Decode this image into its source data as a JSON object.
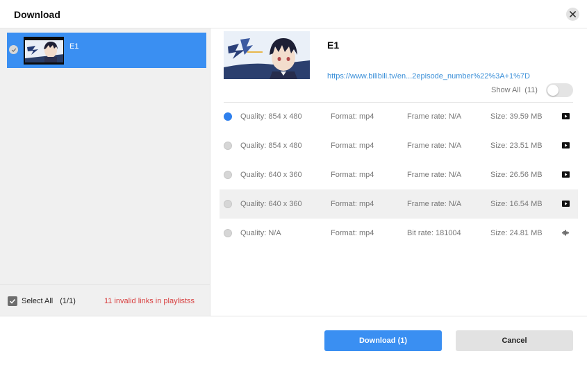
{
  "window": {
    "title": "Download"
  },
  "playlist": {
    "items": [
      {
        "title": "E1",
        "selected": true
      }
    ],
    "select_all_label": "Select All",
    "select_all_count": "(1/1)",
    "invalid_links_text": "11 invalid links in playlistss"
  },
  "video": {
    "title": "E1",
    "url": "https://www.bilibili.tv/en...2episode_number%22%3A+1%7D",
    "show_all_label": "Show All",
    "show_all_count": "(11)",
    "show_all_enabled": false
  },
  "formats": [
    {
      "quality": "Quality: 854 x 480",
      "format": "Format: mp4",
      "rate": "Frame rate: N/A",
      "size": "Size: 39.59 MB",
      "selected": true,
      "icon": "video-icon"
    },
    {
      "quality": "Quality: 854 x 480",
      "format": "Format: mp4",
      "rate": "Frame rate: N/A",
      "size": "Size: 23.51 MB",
      "selected": false,
      "icon": "video-icon"
    },
    {
      "quality": "Quality: 640 x 360",
      "format": "Format: mp4",
      "rate": "Frame rate: N/A",
      "size": "Size: 26.56 MB",
      "selected": false,
      "icon": "video-icon"
    },
    {
      "quality": "Quality: 640 x 360",
      "format": "Format: mp4",
      "rate": "Frame rate: N/A",
      "size": "Size: 16.54 MB",
      "selected": false,
      "icon": "video-icon",
      "hovered": true
    },
    {
      "quality": "Quality: N/A",
      "format": "Format: mp4",
      "rate": "Bit rate: 181004",
      "size": "Size: 24.81 MB",
      "selected": false,
      "icon": "audio-icon"
    }
  ],
  "footer": {
    "download_label": "Download (1)",
    "cancel_label": "Cancel"
  },
  "colors": {
    "accent": "#3a8ff2",
    "error": "#d84040",
    "link": "#3a8fd8"
  }
}
